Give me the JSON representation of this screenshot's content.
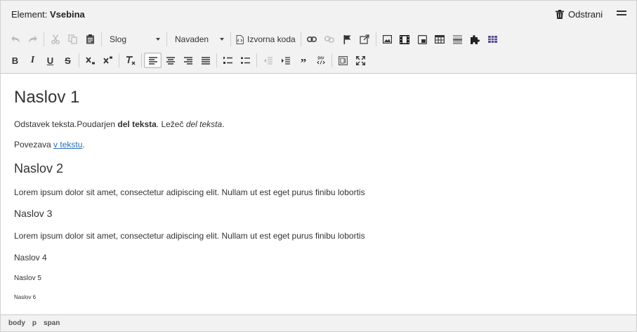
{
  "header": {
    "label": "Element:",
    "element_name": "Vsebina",
    "remove_label": "Odstrani"
  },
  "toolbar": {
    "style_combo": "Slog",
    "format_combo": "Navaden",
    "source_label": "Izvorna koda"
  },
  "content": {
    "h1": "Naslov 1",
    "p1_plain": "Odstavek teksta.Poudarjen ",
    "p1_bold": "del teksta",
    "p1_mid": ". Ležeč ",
    "p1_italic": "del teksta",
    "p1_end": ".",
    "p2_plain": "Povezava ",
    "p2_link": "v tekstu",
    "p2_end": ".",
    "h2": "Naslov 2",
    "lorem1": "Lorem ipsum dolor sit amet, consectetur adipiscing elit. Nullam ut est eget purus finibu lobortis",
    "h3": "Naslov 3",
    "lorem2": "Lorem ipsum dolor sit amet, consectetur adipiscing elit. Nullam ut est eget purus finibu lobortis",
    "h4": "Naslov 4",
    "h5": "Naslov 5",
    "h6": "Naslov 6"
  },
  "statusbar": {
    "path": [
      "body",
      "p",
      "span"
    ]
  }
}
